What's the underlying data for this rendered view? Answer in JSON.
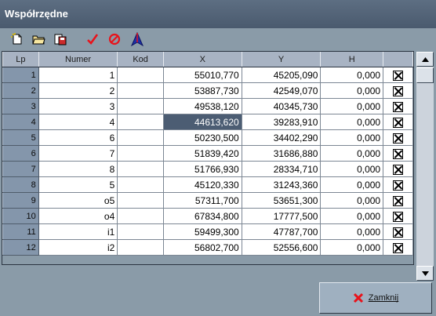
{
  "window": {
    "title": "Współrzędne"
  },
  "toolbar": {
    "icons": [
      "new-file-icon",
      "open-folder-icon",
      "save-icon",
      "checkmark-icon",
      "cancel-icon",
      "arrow-up-icon"
    ]
  },
  "table": {
    "headers": {
      "lp": "Lp",
      "numer": "Numer",
      "kod": "Kod",
      "x": "X",
      "y": "Y",
      "h": "H"
    },
    "rows": [
      {
        "lp": "1",
        "numer": "1",
        "kod": "",
        "x": "55010,770",
        "y": "45205,090",
        "h": "0,000",
        "checked": true
      },
      {
        "lp": "2",
        "numer": "2",
        "kod": "",
        "x": "53887,730",
        "y": "42549,070",
        "h": "0,000",
        "checked": true
      },
      {
        "lp": "3",
        "numer": "3",
        "kod": "",
        "x": "49538,120",
        "y": "40345,730",
        "h": "0,000",
        "checked": true
      },
      {
        "lp": "4",
        "numer": "4",
        "kod": "",
        "x": "44613,620",
        "y": "39283,910",
        "h": "0,000",
        "checked": true
      },
      {
        "lp": "5",
        "numer": "6",
        "kod": "",
        "x": "50230,500",
        "y": "34402,290",
        "h": "0,000",
        "checked": true
      },
      {
        "lp": "6",
        "numer": "7",
        "kod": "",
        "x": "51839,420",
        "y": "31686,880",
        "h": "0,000",
        "checked": true
      },
      {
        "lp": "7",
        "numer": "8",
        "kod": "",
        "x": "51766,930",
        "y": "28334,710",
        "h": "0,000",
        "checked": true
      },
      {
        "lp": "8",
        "numer": "5",
        "kod": "",
        "x": "45120,330",
        "y": "31243,360",
        "h": "0,000",
        "checked": true
      },
      {
        "lp": "9",
        "numer": "o5",
        "kod": "",
        "x": "57311,700",
        "y": "53651,300",
        "h": "0,000",
        "checked": true
      },
      {
        "lp": "10",
        "numer": "o4",
        "kod": "",
        "x": "67834,800",
        "y": "17777,500",
        "h": "0,000",
        "checked": true
      },
      {
        "lp": "11",
        "numer": "i1",
        "kod": "",
        "x": "59499,300",
        "y": "47787,700",
        "h": "0,000",
        "checked": true
      },
      {
        "lp": "12",
        "numer": "i2",
        "kod": "",
        "x": "56802,700",
        "y": "52556,600",
        "h": "0,000",
        "checked": true
      }
    ],
    "selected": {
      "row": 3,
      "column": "x"
    }
  },
  "buttons": {
    "close": "Zamknij"
  },
  "colors": {
    "accent_red": "#e8131b",
    "selected_cell": "#4c5d73",
    "header": "#a8b3c3",
    "row_header": "#8496ab"
  }
}
